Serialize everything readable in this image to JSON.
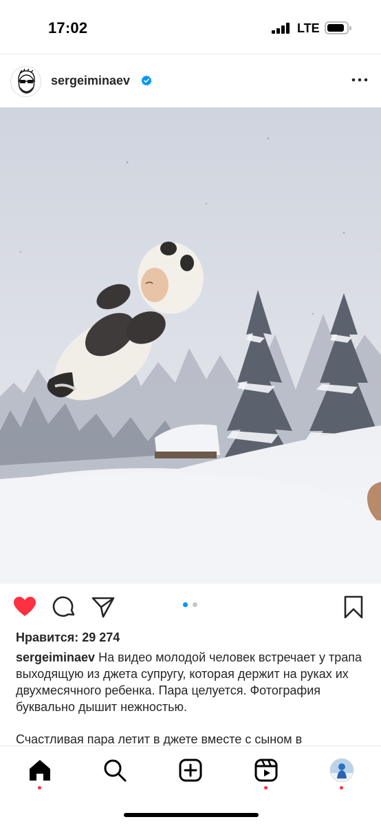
{
  "status_bar": {
    "time": "17:02",
    "network": "LTE"
  },
  "post": {
    "username": "sergeiminaev",
    "verified": true,
    "more_icon": "more-horizontal-icon",
    "carousel": {
      "current": 1,
      "total": 2
    },
    "liked": true,
    "likes_label": "Нравится: 29 274",
    "caption_user": "sergeiminaev",
    "caption_text": "На видео  молодой человек встречает у трапа выходящую из джета супругу,  которая держит на руках их двухмесячного ребенка. Пара целуется. Фотография буквально дышит нежностью.",
    "caption_text_2": "Счастливая пара летит в джете вместе с сыном в"
  },
  "colors": {
    "like_red": "#ff3040",
    "verified_blue": "#0095f6",
    "carousel_active": "#0095f6",
    "carousel_inactive": "#c7c7c7"
  },
  "nav": {
    "items": [
      {
        "name": "home",
        "icon": "home-icon",
        "active": true
      },
      {
        "name": "search",
        "icon": "search-icon"
      },
      {
        "name": "create",
        "icon": "create-post-icon"
      },
      {
        "name": "reels",
        "icon": "reels-icon"
      },
      {
        "name": "profile",
        "icon": "profile-avatar"
      }
    ]
  }
}
